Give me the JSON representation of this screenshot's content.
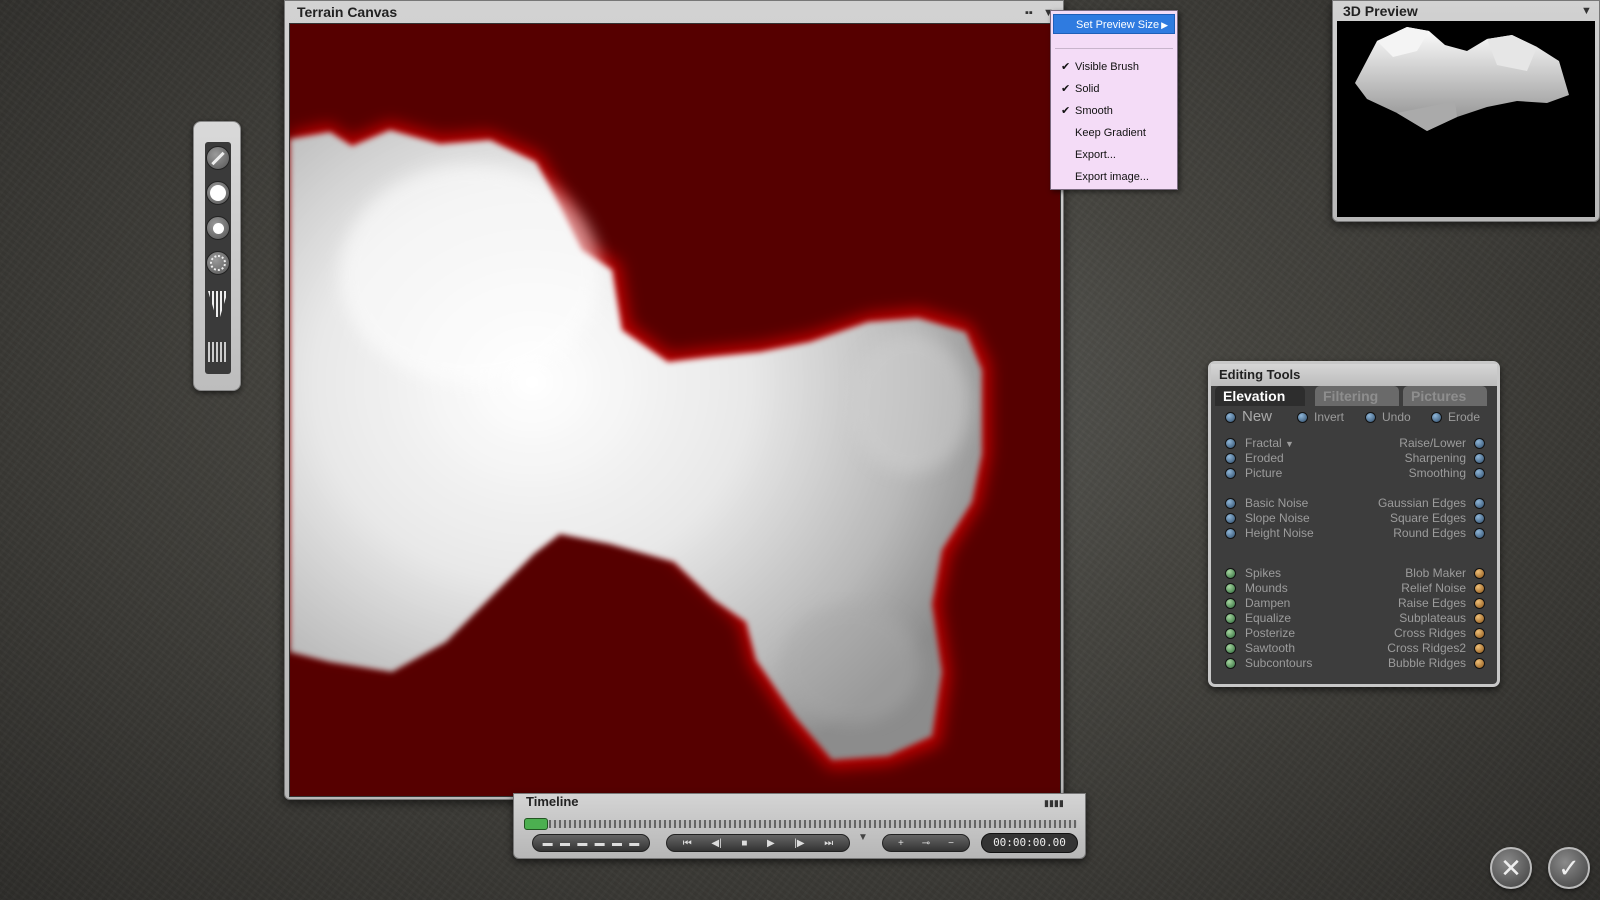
{
  "canvas_window": {
    "title": "Terrain Canvas"
  },
  "context_menu": {
    "items": [
      {
        "label": "Set Preview Size",
        "checked": false,
        "submenu": true,
        "highlighted": true
      },
      {
        "label": "Visible Brush",
        "checked": true
      },
      {
        "label": "Solid",
        "checked": true
      },
      {
        "label": "Smooth",
        "checked": true
      },
      {
        "label": "Keep Gradient",
        "checked": false
      },
      {
        "label": "Export...",
        "checked": false
      },
      {
        "label": "Export image...",
        "checked": false
      }
    ],
    "check_glyph": "✔",
    "submenu_glyph": "▶"
  },
  "preview_window": {
    "title": "3D Preview"
  },
  "timeline": {
    "title": "Timeline",
    "timecode": "00:00:00.00"
  },
  "editing_tools": {
    "title": "Editing Tools",
    "tabs": [
      {
        "label": "Elevation",
        "active": true
      },
      {
        "label": "Filtering",
        "active": false
      },
      {
        "label": "Pictures",
        "active": false
      }
    ],
    "top_row": {
      "new": "New",
      "invert": "Invert",
      "undo": "Undo",
      "erode": "Erode"
    },
    "left_items": [
      "Fractal",
      "Eroded",
      "Picture",
      "Basic Noise",
      "Slope Noise",
      "Height Noise",
      "Spikes",
      "Mounds",
      "Dampen",
      "Equalize",
      "Posterize",
      "Sawtooth",
      "Subcontours"
    ],
    "right_items": [
      "Raise/Lower",
      "Sharpening",
      "Smoothing",
      "Gaussian Edges",
      "Square Edges",
      "Round Edges",
      "Blob Maker",
      "Relief Noise",
      "Raise Edges",
      "Subplateaus",
      "Cross Ridges",
      "Cross Ridges2",
      "Bubble Ridges"
    ]
  },
  "buttons": {
    "cancel": "✕",
    "ok": "✓"
  },
  "colors": {
    "terrain_bg": "#560000",
    "terrain_edge": "#c00000",
    "menu_bg": "#f4dcf7",
    "menu_highlight": "#2f7be0"
  }
}
